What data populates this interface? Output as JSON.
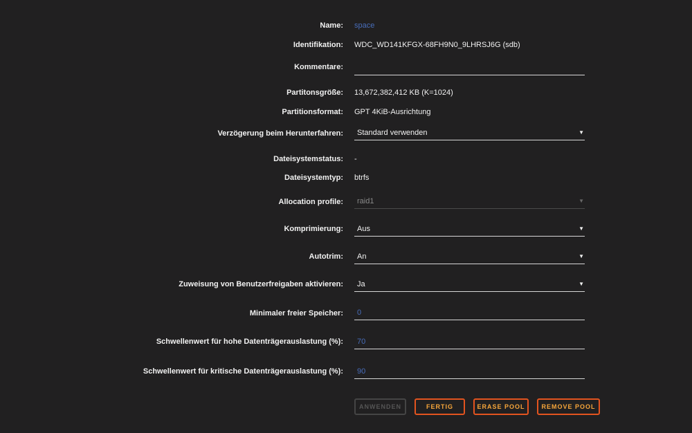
{
  "form": {
    "name": {
      "label": "Name:",
      "value": "space"
    },
    "identifikation": {
      "label": "Identifikation:",
      "value": "WDC_WD141KFGX-68FH9N0_9LHRSJ6G (sdb)"
    },
    "kommentare": {
      "label": "Kommentare:",
      "value": ""
    },
    "partitionsgroesse": {
      "label": "Partitonsgröße:",
      "value": "13,672,382,412 KB (K=1024)"
    },
    "partitionsformat": {
      "label": "Partitionsformat:",
      "value": "GPT 4KiB-Ausrichtung"
    },
    "verzoegerung": {
      "label": "Verzögerung beim Herunterfahren:",
      "value": "Standard verwenden"
    },
    "dateisystemstatus": {
      "label": "Dateisystemstatus:",
      "value": "-"
    },
    "dateisystemtyp": {
      "label": "Dateisystemtyp:",
      "value": "btrfs"
    },
    "allocation": {
      "label": "Allocation profile:",
      "value": "raid1"
    },
    "komprimierung": {
      "label": "Komprimierung:",
      "value": "Aus"
    },
    "autotrim": {
      "label": "Autotrim:",
      "value": "An"
    },
    "zuweisung": {
      "label": "Zuweisung von Benutzerfreigaben aktivieren:",
      "value": "Ja"
    },
    "min_speicher": {
      "label": "Minimaler freier Speicher:",
      "value": "0"
    },
    "hohe_auslastung": {
      "label": "Schwellenwert für hohe Datenträgerauslastung (%):",
      "value": "70"
    },
    "kritische_auslastung": {
      "label": "Schwellenwert für kritische Datenträgerauslastung (%):",
      "value": "90"
    }
  },
  "buttons": {
    "anwenden": "ANWENDEN",
    "fertig": "FERTIG",
    "erase": "ERASE POOL",
    "remove": "REMOVE POOL"
  },
  "icons": {
    "dropdown": "chevron-down-icon"
  },
  "colors": {
    "background": "#212021",
    "accent": "#e3541f",
    "link": "#486dba"
  }
}
